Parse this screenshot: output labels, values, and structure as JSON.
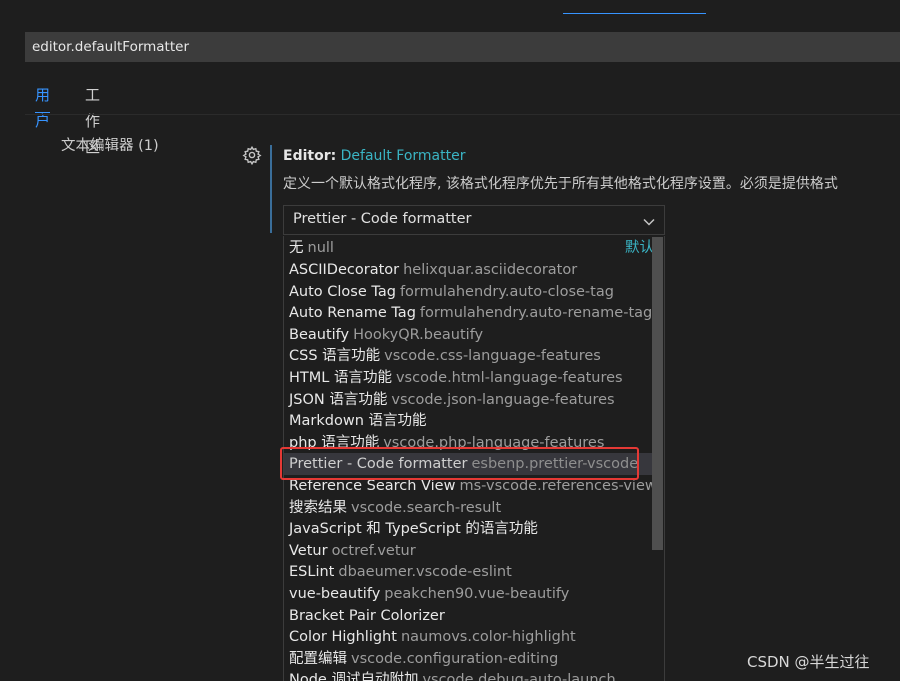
{
  "search": {
    "value": "editor.defaultFormatter"
  },
  "scope_tabs": [
    {
      "label": "用户",
      "active": true
    },
    {
      "label": "工作区",
      "active": false
    }
  ],
  "toc": {
    "item": "文本编辑器 (1)"
  },
  "setting": {
    "category": "Editor:",
    "key": "Default Formatter",
    "description": "定义一个默认格式化程序, 该格式化程序优先于所有其他格式化程序设置。必须是提供格式"
  },
  "dropdown": {
    "selected_value": "Prettier - Code formatter",
    "default_label": "默认",
    "options": [
      {
        "name": "无",
        "id": "null",
        "is_default": true
      },
      {
        "name": "ASCIIDecorator",
        "id": "helixquar.asciidecorator"
      },
      {
        "name": "Auto Close Tag",
        "id": "formulahendry.auto-close-tag"
      },
      {
        "name": "Auto Rename Tag",
        "id": "formulahendry.auto-rename-tag"
      },
      {
        "name": "Beautify",
        "id": "HookyQR.beautify"
      },
      {
        "name": "CSS 语言功能",
        "id": "vscode.css-language-features"
      },
      {
        "name": "HTML 语言功能",
        "id": "vscode.html-language-features"
      },
      {
        "name": "JSON 语言功能",
        "id": "vscode.json-language-features"
      },
      {
        "name": "Markdown 语言功能",
        "id": ""
      },
      {
        "name": "php 语言功能",
        "id": "vscode.php-language-features"
      },
      {
        "name": "Prettier - Code formatter",
        "id": "esbenp.prettier-vscode",
        "selected": true
      },
      {
        "name": "Reference Search View",
        "id": "ms-vscode.references-view"
      },
      {
        "name": "搜索结果",
        "id": "vscode.search-result"
      },
      {
        "name": "JavaScript 和 TypeScript 的语言功能",
        "id": ""
      },
      {
        "name": "Vetur",
        "id": "octref.vetur"
      },
      {
        "name": "ESLint",
        "id": "dbaeumer.vscode-eslint"
      },
      {
        "name": "vue-beautify",
        "id": "peakchen90.vue-beautify"
      },
      {
        "name": "Bracket Pair Colorizer",
        "id": ""
      },
      {
        "name": "Color Highlight",
        "id": "naumovs.color-highlight"
      },
      {
        "name": "配置编辑",
        "id": "vscode.configuration-editing"
      },
      {
        "name": "Node 调试自动附加",
        "id": "vscode.debug-auto-launch"
      }
    ]
  },
  "watermark": "CSDN @半生过往",
  "colors": {
    "background": "#1e1e1e",
    "accent": "#3794ff",
    "setting_key": "#3ab4c4",
    "highlight_border": "#e53935"
  },
  "icons": {
    "gear": "gear-icon",
    "chevron": "chevron-down-icon"
  }
}
